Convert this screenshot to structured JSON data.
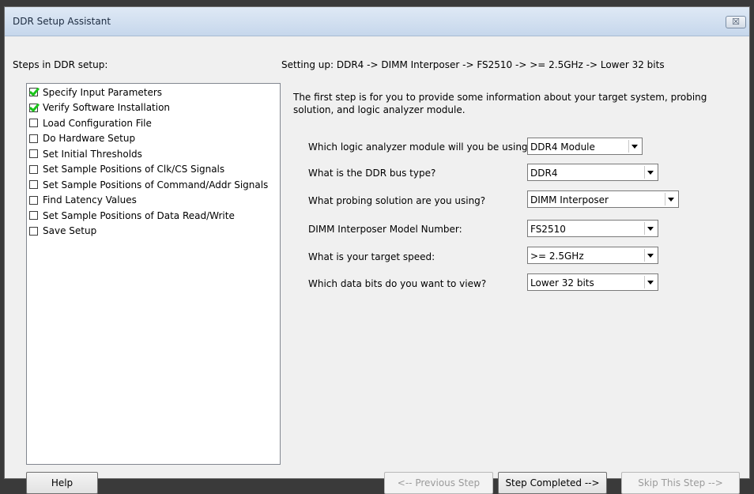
{
  "window": {
    "title": "DDR Setup Assistant",
    "close_glyph": "☒"
  },
  "steps_heading": "Steps in DDR setup:",
  "setting_up": "Setting up: DDR4 -> DIMM Interposer -> FS2510 -> >= 2.5GHz -> Lower 32 bits",
  "steps": [
    {
      "label": "Specify Input Parameters",
      "checked": true
    },
    {
      "label": "Verify Software Installation",
      "checked": true
    },
    {
      "label": "Load Configuration File",
      "checked": false
    },
    {
      "label": "Do Hardware Setup",
      "checked": false
    },
    {
      "label": "Set Initial Thresholds",
      "checked": false
    },
    {
      "label": "Set Sample Positions of Clk/CS Signals",
      "checked": false
    },
    {
      "label": "Set Sample Positions of Command/Addr Signals",
      "checked": false
    },
    {
      "label": "Find Latency Values",
      "checked": false
    },
    {
      "label": "Set Sample Positions of Data Read/Write",
      "checked": false
    },
    {
      "label": "Save Setup",
      "checked": false
    }
  ],
  "intro": "The first step is for you to provide some information about your target system, probing solution, and logic analyzer module.",
  "questions": [
    {
      "label": "Which logic analyzer module will you be using?",
      "value": "DDR4 Module"
    },
    {
      "label": "What is the DDR bus type?",
      "value": "DDR4"
    },
    {
      "label": "What probing solution are you using?",
      "value": "DIMM Interposer"
    },
    {
      "label": "DIMM Interposer Model Number:",
      "value": "FS2510"
    },
    {
      "label": "What is your target speed:",
      "value": ">= 2.5GHz"
    },
    {
      "label": "Which data bits do you want to view?",
      "value": "Lower 32 bits"
    }
  ],
  "buttons": {
    "help": "Help",
    "previous": "<-- Previous Step",
    "completed": "Step Completed -->",
    "skip": "Skip This Step -->"
  }
}
